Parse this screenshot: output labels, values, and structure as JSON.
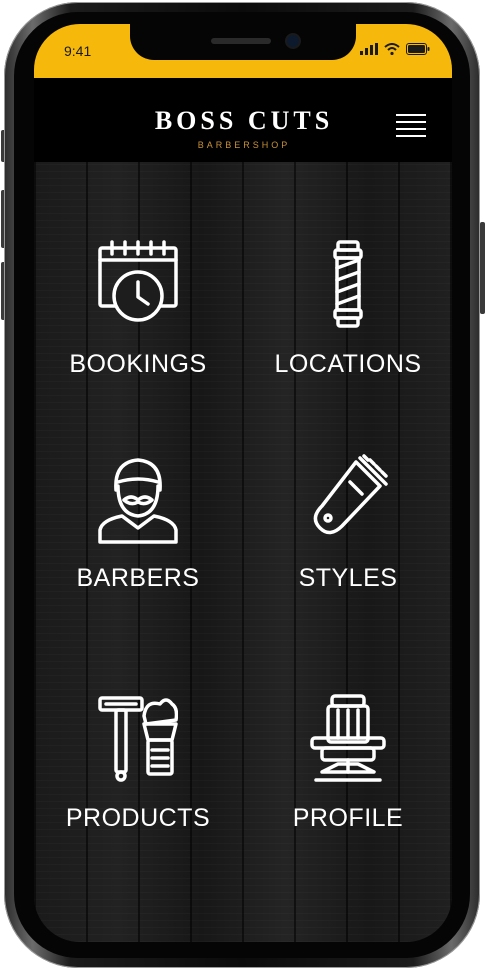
{
  "status_bar": {
    "time": "9:41",
    "background_color": "#f6b90b",
    "icons": [
      "signal-icon",
      "wifi-icon",
      "battery-icon"
    ]
  },
  "header": {
    "brand_name": "BOSS CUTS",
    "brand_subtitle": "BARBERSHOP",
    "menu_icon": "hamburger-menu-icon",
    "subtitle_color": "#c8923a"
  },
  "tiles": [
    {
      "label": "BOOKINGS",
      "icon": "calendar-clock-icon"
    },
    {
      "label": "LOCATIONS",
      "icon": "barber-pole-icon"
    },
    {
      "label": "BARBERS",
      "icon": "barber-person-icon"
    },
    {
      "label": "STYLES",
      "icon": "hair-clipper-icon"
    },
    {
      "label": "PRODUCTS",
      "icon": "razor-shaving-brush-icon"
    },
    {
      "label": "PROFILE",
      "icon": "barber-chair-icon"
    }
  ]
}
